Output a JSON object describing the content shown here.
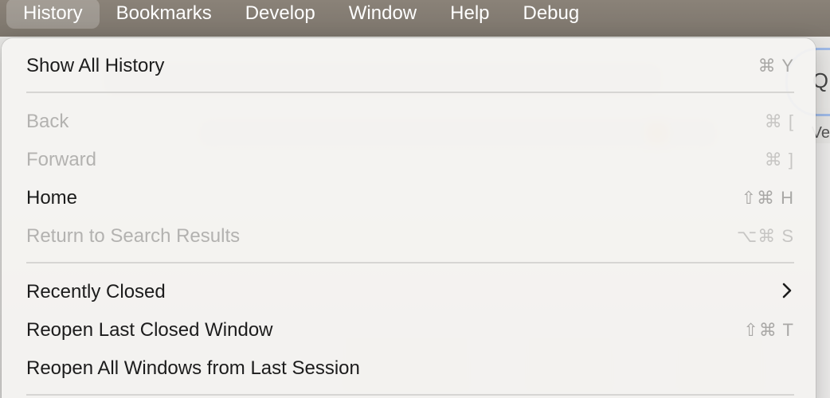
{
  "menubar": {
    "items": [
      {
        "label": "History",
        "active": true
      },
      {
        "label": "Bookmarks"
      },
      {
        "label": "Develop"
      },
      {
        "label": "Window"
      },
      {
        "label": "Help"
      },
      {
        "label": "Debug"
      }
    ]
  },
  "background": {
    "search_glyph": "Q",
    "partial_text": "Ve"
  },
  "menu": {
    "items": [
      {
        "label": "Show All History",
        "shortcut": "⌘ Y",
        "enabled": true
      },
      {
        "label": "Back",
        "shortcut": "⌘ [",
        "enabled": false
      },
      {
        "label": "Forward",
        "shortcut": "⌘ ]",
        "enabled": false
      },
      {
        "label": "Home",
        "shortcut": "⇧⌘ H",
        "enabled": true
      },
      {
        "label": "Return to Search Results",
        "shortcut": "⌥⌘ S",
        "enabled": false
      },
      {
        "label": "Recently Closed",
        "submenu_icon": "chevron-right-icon",
        "enabled": true
      },
      {
        "label": "Reopen Last Closed Window",
        "shortcut": "⇧⌘ T",
        "enabled": true
      },
      {
        "label": "Reopen All Windows from Last Session",
        "shortcut": "",
        "enabled": true
      }
    ]
  },
  "colors": {
    "menubar_bg": "#7c756c",
    "menu_bg": "#f4f3f1",
    "text": "#1c1c1c",
    "disabled_text": "#b3b2b0"
  }
}
